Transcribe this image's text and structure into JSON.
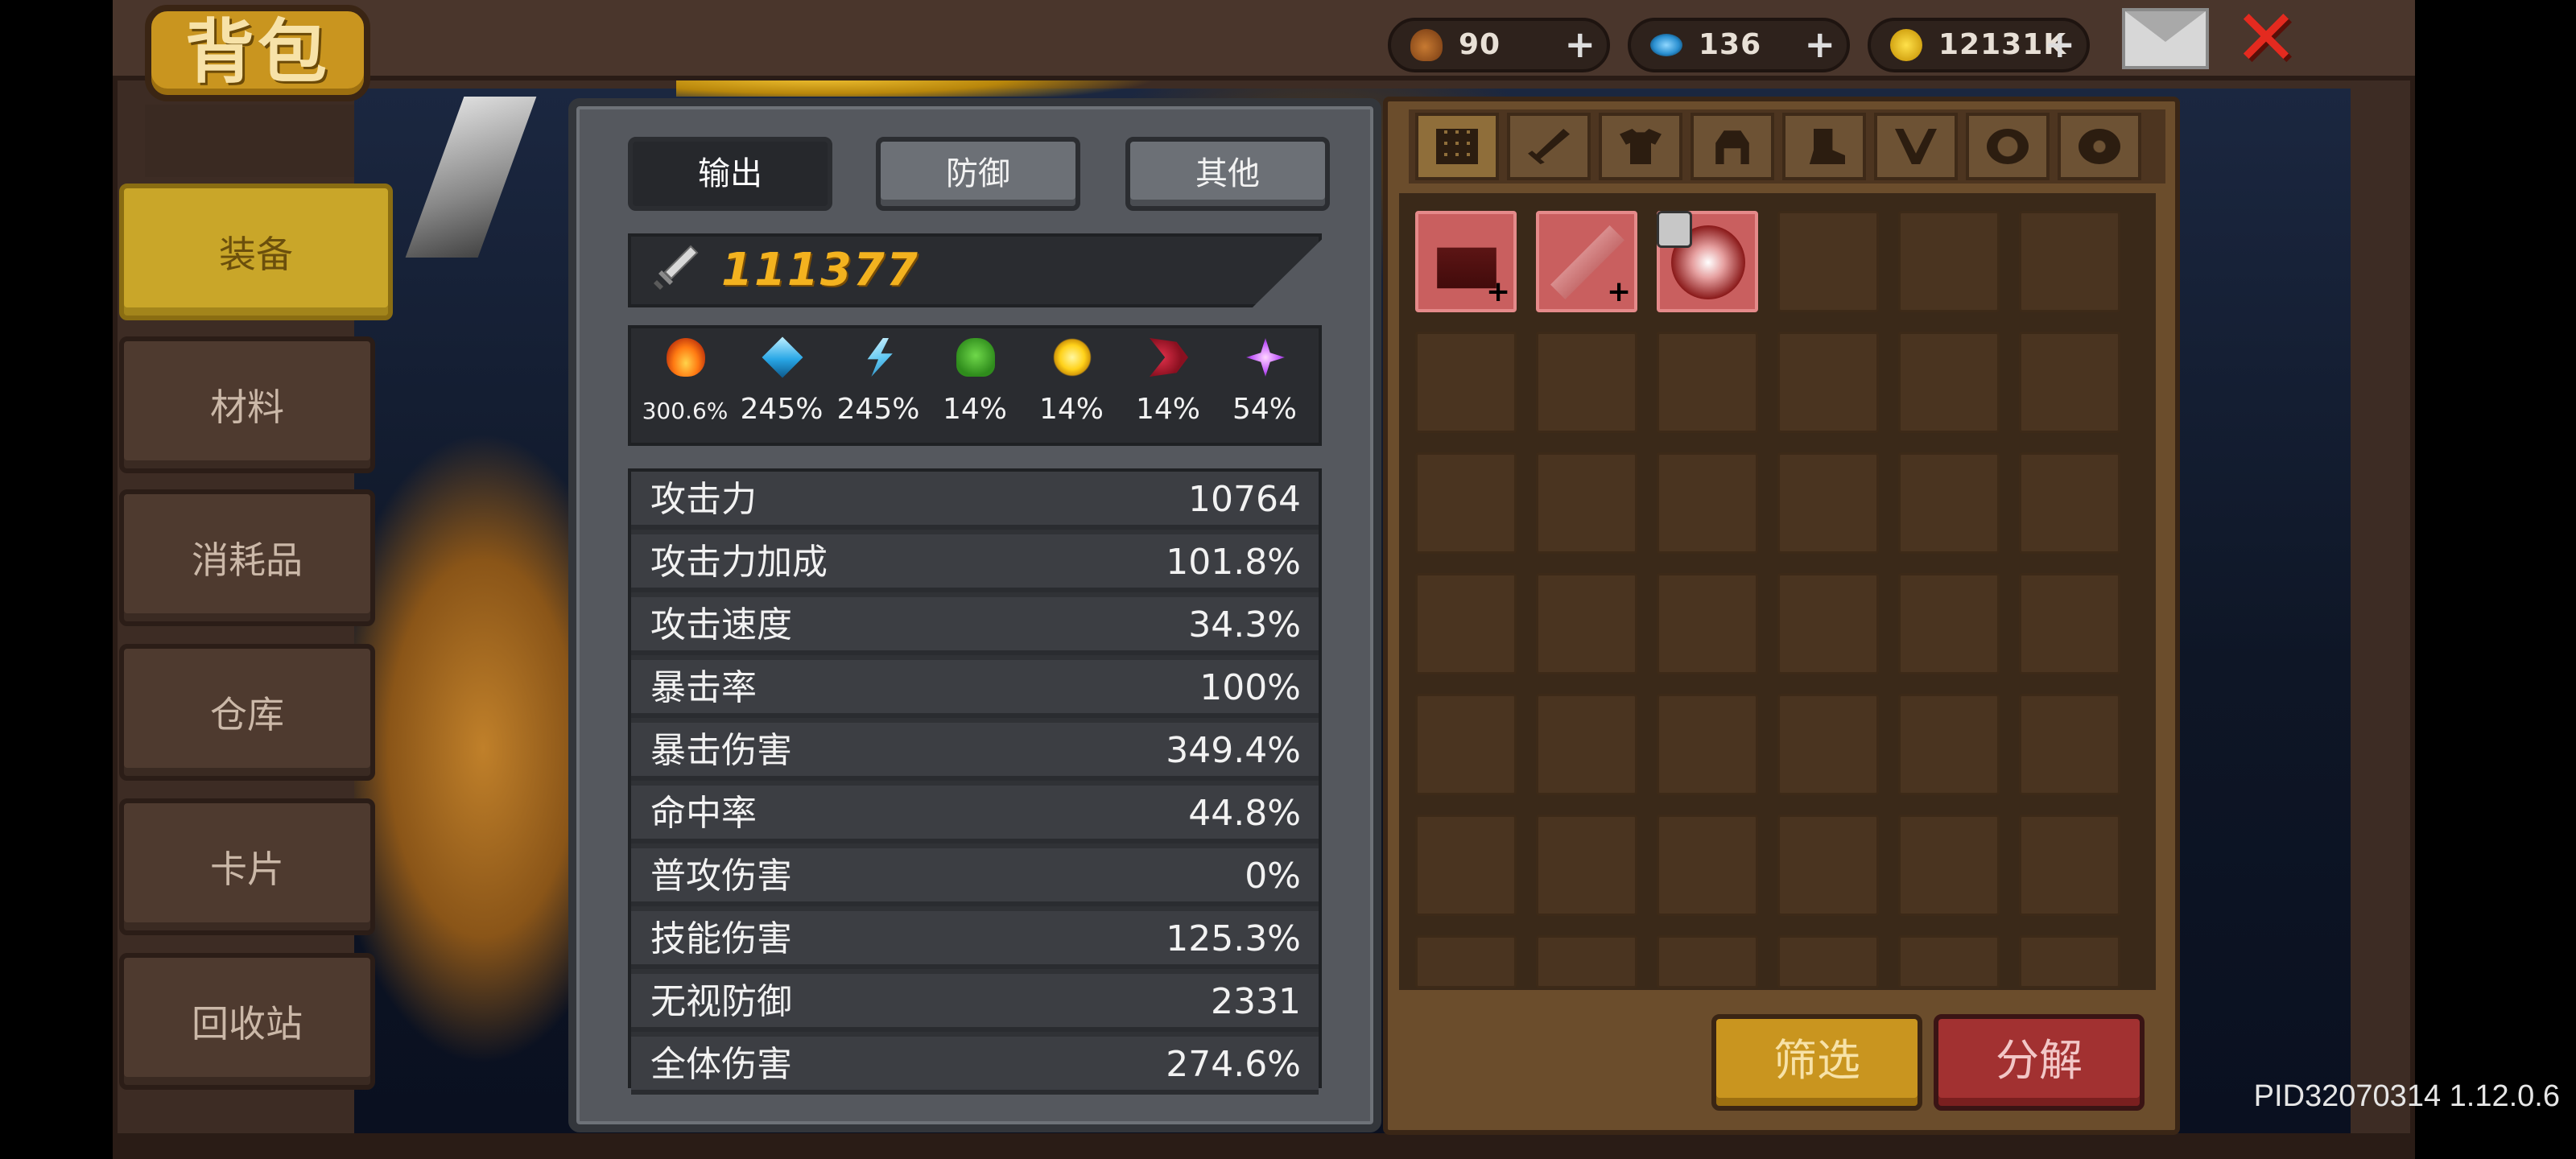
{
  "title": "背包",
  "sidebar": {
    "items": [
      {
        "label": "装备",
        "active": true
      },
      {
        "label": "材料",
        "active": false
      },
      {
        "label": "消耗品",
        "active": false
      },
      {
        "label": "仓库",
        "active": false
      },
      {
        "label": "卡片",
        "active": false
      },
      {
        "label": "回收站",
        "active": false
      }
    ]
  },
  "currency": {
    "potion": "90",
    "gem": "136",
    "gold": "12131K",
    "plus": "+"
  },
  "stats": {
    "tabs": [
      "输出",
      "防御",
      "其他"
    ],
    "active_tab": "输出",
    "power": "111377",
    "elements": [
      {
        "icon": "fire-icon",
        "value": "300.6%"
      },
      {
        "icon": "ice-icon",
        "value": "245%"
      },
      {
        "icon": "lightning-icon",
        "value": "245%"
      },
      {
        "icon": "poison-skull-icon",
        "value": "14%"
      },
      {
        "icon": "light-sun-icon",
        "value": "14%"
      },
      {
        "icon": "dark-crescent-icon",
        "value": "14%"
      },
      {
        "icon": "arcane-star-icon",
        "value": "54%"
      }
    ],
    "rows": [
      {
        "name": "攻击力",
        "value": "10764"
      },
      {
        "name": "攻击力加成",
        "value": "101.8%"
      },
      {
        "name": "攻击速度",
        "value": "34.3%"
      },
      {
        "name": "暴击率",
        "value": "100%"
      },
      {
        "name": "暴击伤害",
        "value": "349.4%"
      },
      {
        "name": "命中率",
        "value": "44.8%"
      },
      {
        "name": "普攻伤害",
        "value": "0%"
      },
      {
        "name": "技能伤害",
        "value": "125.3%"
      },
      {
        "name": "无视防御",
        "value": "2331"
      },
      {
        "name": "全体伤害",
        "value": "274.6%"
      }
    ]
  },
  "inventory": {
    "filter_tabs": [
      "all-grid-icon",
      "weapon-sword-icon",
      "armor-icon",
      "helmet-icon",
      "boots-icon",
      "necklace-icon",
      "ring-icon",
      "gear-icon"
    ],
    "items": [
      {
        "icon": "red-chest-armor-icon",
        "locked": false,
        "badge": "+"
      },
      {
        "icon": "crossbow-icon",
        "locked": false,
        "badge": "+"
      },
      {
        "icon": "amulet-icon",
        "locked": true,
        "badge": ""
      }
    ],
    "filter_button": "筛选",
    "salvage_button": "分解"
  },
  "version": "PID32070314 1.12.0.6",
  "colors": {
    "gold_accent": "#c9951f",
    "red_button": "#a23131",
    "power_text": "#f3b21f",
    "item_rarity_red": "#c95f5f"
  }
}
